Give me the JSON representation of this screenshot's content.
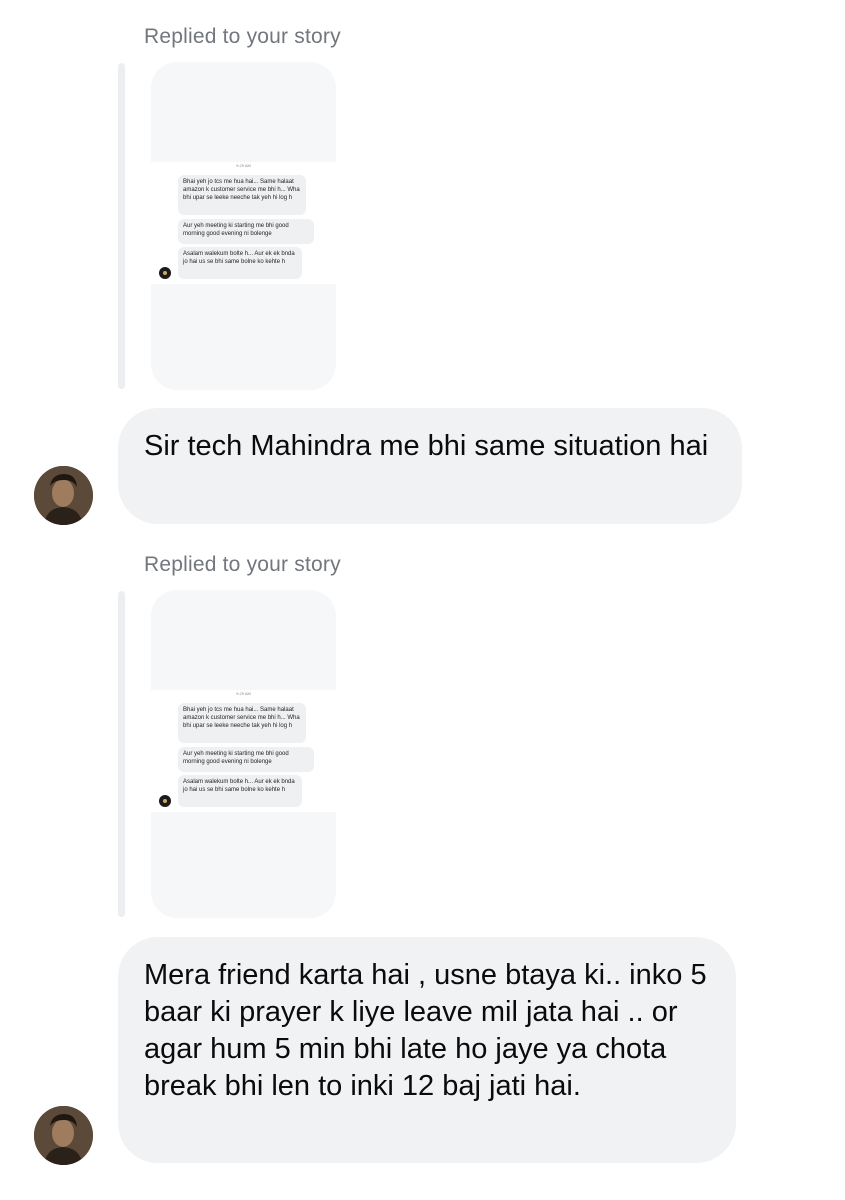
{
  "messages": [
    {
      "reply_label": "Replied to your story",
      "story": {
        "time": "9:29 AM",
        "bubbles": [
          "Bhai yeh jo tcs me hua hai... Same halaat amazon k customer service me bhi h... Wha bhi upar se leeke neeche tak yeh hi log h",
          "Aur yeh meeting ki starting me bhi good morning good evening ni bolenge",
          "Asalam walekum bolte h... Aur ek ek bnda jo hai us se bhi same bolne ko kehte h"
        ]
      },
      "text": "Sir tech Mahindra me bhi same situation hai"
    },
    {
      "reply_label": "Replied to your story",
      "story": {
        "time": "9:29 AM",
        "bubbles": [
          "Bhai yeh jo tcs me hua hai... Same halaat amazon k customer service me bhi h... Wha bhi upar se leeke neeche tak yeh hi log h",
          "Aur yeh meeting ki starting me bhi good morning good evening ni bolenge",
          "Asalam walekum bolte h... Aur ek ek bnda jo hai us se bhi same bolne ko kehte h"
        ]
      },
      "text": "Mera friend karta hai , usne btaya ki.. inko 5 baar ki prayer k liye leave mil jata hai .. or agar hum 5 min bhi late ho jaye ya chota break bhi len to inki 12 baj jati hai."
    }
  ]
}
